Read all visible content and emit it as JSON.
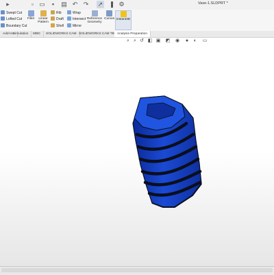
{
  "document": {
    "title": "Vase-1.SLDPRT *"
  },
  "quick_access": {
    "icons": [
      "solidworks-menu-icon",
      "new-icon",
      "open-icon",
      "save-icon",
      "print-icon",
      "undo-icon",
      "redo-icon",
      "select-icon",
      "rebuild-icon",
      "options-icon"
    ]
  },
  "ribbon": {
    "left_features": [
      {
        "label": "Swept Cut",
        "icon": "swept-cut-icon",
        "color": "#6b8fc9"
      },
      {
        "label": "Lofted Cut",
        "icon": "lofted-cut-icon",
        "color": "#6b8fc9"
      },
      {
        "label": "Boundary Cut",
        "icon": "boundary-cut-icon",
        "color": "#6b8fc9"
      }
    ],
    "tools": [
      {
        "label": "Fillet",
        "icon": "fillet-icon",
        "color": "#8aa6d6"
      },
      {
        "label": "Linear Pattern",
        "icon": "linear-pattern-icon",
        "color": "#e2b04a"
      },
      {
        "label": "Rib",
        "icon": "rib-icon",
        "color": "#c9a54c"
      },
      {
        "label": "Draft",
        "icon": "draft-icon",
        "color": "#c9a54c"
      },
      {
        "label": "Shell",
        "icon": "shell-icon",
        "color": "#d9a441"
      },
      {
        "label": "Wrap",
        "icon": "wrap-icon",
        "color": "#7aa3d8"
      },
      {
        "label": "Intersect",
        "icon": "intersect-icon",
        "color": "#7aa3d8"
      },
      {
        "label": "Mirror",
        "icon": "mirror-icon",
        "color": "#7aa3d8"
      },
      {
        "label": "Reference Geometry",
        "icon": "reference-geometry-icon",
        "color": "#9bb0cf"
      },
      {
        "label": "Curves",
        "icon": "curves-icon",
        "color": "#7d9bc8"
      },
      {
        "label": "Instant3D",
        "icon": "instant3d-icon",
        "color": "#f0c419"
      }
    ]
  },
  "tabs": [
    {
      "label": "Add-Ins",
      "active": false
    },
    {
      "label": "Simulation",
      "active": false
    },
    {
      "label": "MBD",
      "active": false
    },
    {
      "label": "SOLIDWORKS CAM",
      "active": false
    },
    {
      "label": "SOLIDWORKS CAM TBM",
      "active": false
    },
    {
      "label": "Analysis Preparation",
      "active": true
    }
  ],
  "heads_up_toolbar": [
    "zoom-to-fit-icon",
    "zoom-to-area-icon",
    "previous-view-icon",
    "section-view-icon",
    "view-orientation-icon",
    "display-style-icon",
    "hide-show-items-icon",
    "edit-appearance-icon",
    "apply-scene-icon",
    "view-settings-icon"
  ],
  "model": {
    "name": "twisted vase",
    "body_color": "#1846c8",
    "groove_color": "#0a0f1e"
  }
}
